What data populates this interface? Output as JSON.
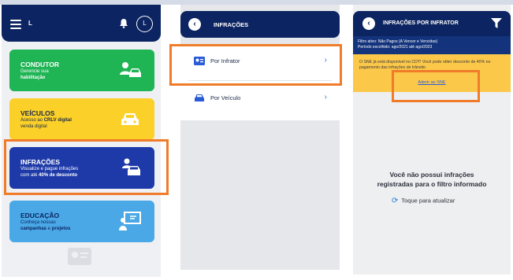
{
  "panel1": {
    "user_initial": "L",
    "avatar_initial": "L",
    "cards": {
      "condutor": {
        "title": "CONDUTOR",
        "desc_line1": "Gerencie sua",
        "desc_line2": "habilitação"
      },
      "veiculos": {
        "title": "VEÍCULOS",
        "desc_prefix": "Acesso ao ",
        "desc_bold": "CRLV digital",
        "desc_line2": "venda digital"
      },
      "infracoes": {
        "title": "INFRAÇÕES",
        "desc_line1": "Visualize e pague infrações",
        "desc_prefix": "com até ",
        "desc_bold": "40% de desconto"
      },
      "educacao": {
        "title": "EDUCAÇÃO",
        "desc_line1": "Conheça nossas",
        "desc_bold1": "campanhas",
        "desc_mid": " e ",
        "desc_bold2": "projetos"
      }
    }
  },
  "panel2": {
    "title": "INFRAÇÕES",
    "rows": [
      {
        "label": "Por Infrator",
        "icon": "id-card-icon"
      },
      {
        "label": "Por Veículo",
        "icon": "car-icon"
      }
    ]
  },
  "panel3": {
    "title": "INFRAÇÕES POR INFRATOR",
    "filter_line1": "Filtro ativo: Não Pagos (A Vencer e Vencidas)",
    "filter_line2": "Período escolhido: ago/2021 até ago/2023",
    "notice": "O SNE já está disponível no CDT! Você pode obter desconto de 40% no pagamento das infrações de trânsito",
    "notice_link": "Aderir ao SNE",
    "empty_line1": "Você não possui infrações",
    "empty_line2": "registradas para o filtro informado",
    "refresh_label": "Toque para atualizar"
  },
  "colors": {
    "navy": "#0c2461",
    "highlight": "#f07c2a",
    "green": "#1fb454",
    "yellow": "#fbd028",
    "blue": "#1e3aa8",
    "light_blue": "#4aa8e6",
    "notice": "#fcc84a"
  }
}
